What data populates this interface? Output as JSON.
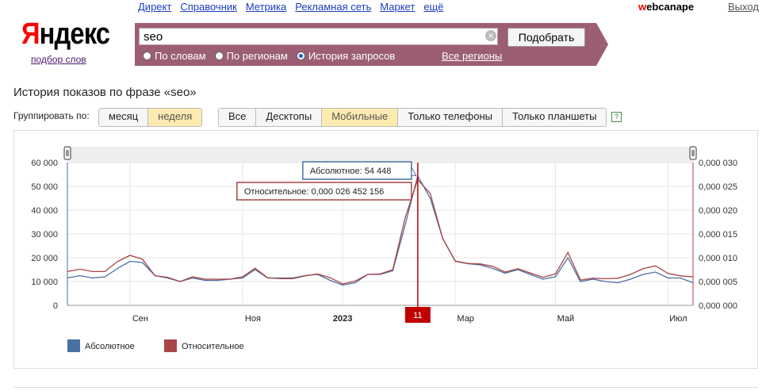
{
  "topnav": [
    "Директ",
    "Справочник",
    "Метрика",
    "Рекламная сеть",
    "Маркет",
    "ещё"
  ],
  "user": {
    "first_letter": "w",
    "rest": "ebcanape"
  },
  "exit_label": "Выход",
  "logo": {
    "text_red": "Я",
    "text_black": "ндекс",
    "sublabel": "подбор слов"
  },
  "search": {
    "value": "seo",
    "button": "Подобрать",
    "clear_icon": "clear-icon"
  },
  "modes": [
    {
      "label": "По словам",
      "selected": false
    },
    {
      "label": "По регионам",
      "selected": false
    },
    {
      "label": "История запросов",
      "selected": true
    }
  ],
  "regions_label": "Все регионы",
  "page_title": "История показов по фразе «seo»",
  "group_label": "Группировать по:",
  "group_options": [
    {
      "label": "месяц",
      "active": false
    },
    {
      "label": "неделя",
      "active": true
    }
  ],
  "device_options": [
    {
      "label": "Все",
      "active": false
    },
    {
      "label": "Десктопы",
      "active": false
    },
    {
      "label": "Мобильные",
      "active": true
    },
    {
      "label": "Только телефоны",
      "active": false
    },
    {
      "label": "Только планшеты",
      "active": false
    }
  ],
  "help_label": "?",
  "colors": {
    "accent_bar": "#9c5e75",
    "absolute": "#4a6fa5",
    "relative": "#a84545",
    "marker": "#c00000"
  },
  "chart_data": {
    "type": "line",
    "x": [
      "2022-08-01",
      "2022-08-08",
      "2022-08-15",
      "2022-08-22",
      "2022-08-29",
      "2022-09-05",
      "2022-09-12",
      "2022-09-19",
      "2022-09-26",
      "2022-10-03",
      "2022-10-10",
      "2022-10-17",
      "2022-10-24",
      "2022-10-31",
      "2022-11-07",
      "2022-11-14",
      "2022-11-21",
      "2022-11-28",
      "2022-12-05",
      "2022-12-12",
      "2022-12-19",
      "2022-12-26",
      "2023-01-02",
      "2023-01-09",
      "2023-01-16",
      "2023-01-23",
      "2023-01-30",
      "2023-02-06",
      "2023-02-13",
      "2023-02-20",
      "2023-02-27",
      "2023-03-06",
      "2023-03-13",
      "2023-03-20",
      "2023-03-27",
      "2023-04-03",
      "2023-04-10",
      "2023-04-17",
      "2023-04-24",
      "2023-05-01",
      "2023-05-08",
      "2023-05-15",
      "2023-05-22",
      "2023-05-29",
      "2023-06-05",
      "2023-06-12",
      "2023-06-19",
      "2023-06-26",
      "2023-07-03",
      "2023-07-10",
      "2023-07-17"
    ],
    "series": [
      {
        "name": "Абсолютное",
        "axis": "left",
        "values": [
          11500,
          12500,
          11500,
          12000,
          15500,
          18500,
          18000,
          12500,
          11500,
          10000,
          11500,
          10500,
          10500,
          11000,
          11500,
          15000,
          11500,
          11500,
          11500,
          12500,
          13000,
          10500,
          8500,
          9500,
          13000,
          13000,
          14500,
          34000,
          54448,
          45000,
          28000,
          18500,
          17500,
          17000,
          15500,
          13500,
          15000,
          13000,
          11000,
          12000,
          20000,
          10000,
          11000,
          10000,
          9500,
          11000,
          13000,
          14000,
          11500,
          11500,
          9500
        ]
      },
      {
        "name": "Относительное",
        "axis": "right",
        "values": [
          0.0071,
          0.0076,
          0.0071,
          0.0071,
          0.0092,
          0.0105,
          0.0097,
          0.0062,
          0.0059,
          0.005,
          0.006,
          0.0055,
          0.0055,
          0.0055,
          0.006,
          0.0078,
          0.0058,
          0.0056,
          0.0056,
          0.0062,
          0.0066,
          0.0058,
          0.0045,
          0.0051,
          0.0065,
          0.0066,
          0.0075,
          0.0185,
          0.0264,
          0.0235,
          0.014,
          0.0093,
          0.0088,
          0.0087,
          0.0082,
          0.007,
          0.0077,
          0.0068,
          0.0059,
          0.0066,
          0.0111,
          0.0053,
          0.0057,
          0.0056,
          0.0057,
          0.0065,
          0.0077,
          0.0083,
          0.0067,
          0.0062,
          0.006
        ]
      }
    ],
    "ylim_left": [
      0,
      60000
    ],
    "ylim_right": [
      0,
      0.03
    ],
    "y_ticks_left": [
      "0",
      "10 000",
      "20 000",
      "30 000",
      "40 000",
      "50 000",
      "60 000"
    ],
    "y_ticks_right": [
      "0,000 000",
      "0,000 005",
      "0,000 010",
      "0,000 015",
      "0,000 020",
      "0,000 025",
      "0,000 030"
    ],
    "x_labels": [
      {
        "label": "Сен",
        "date": "2022-09-05",
        "bold": false
      },
      {
        "label": "Ноя",
        "date": "2022-11-07",
        "bold": false
      },
      {
        "label": "2023",
        "date": "2023-01-02",
        "bold": true
      },
      {
        "label": "Мар",
        "date": "2023-03-06",
        "bold": false
      },
      {
        "label": "Май",
        "date": "2023-05-01",
        "bold": false
      },
      {
        "label": "Июл",
        "date": "2023-07-03",
        "bold": false
      }
    ],
    "selected": {
      "date": "2023-02-13",
      "label": "11"
    },
    "tooltip_absolute": "Абсолютное: 54 448",
    "tooltip_relative": "Относительное: 0,000 026 452 156",
    "legend": [
      "Абсолютное",
      "Относительное"
    ],
    "legend_position": "bottom-left",
    "grid": true
  }
}
